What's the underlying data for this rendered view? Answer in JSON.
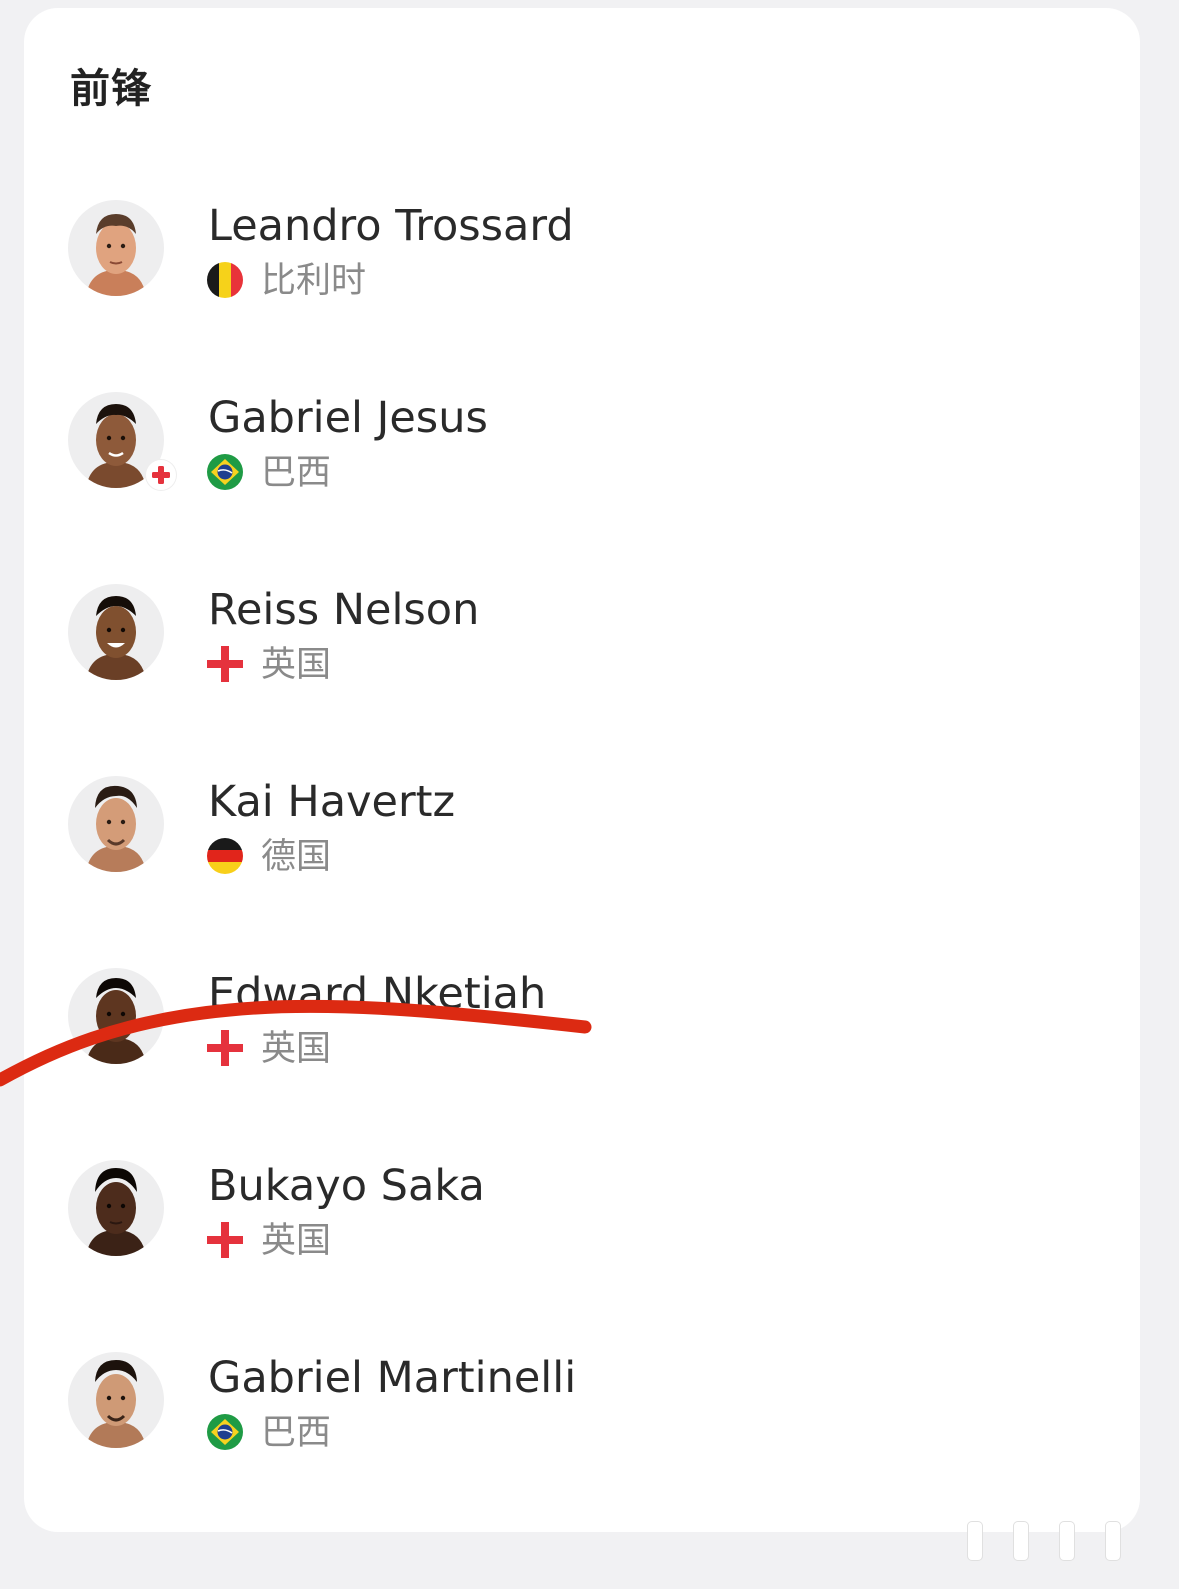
{
  "section": {
    "title": "前锋"
  },
  "players": [
    {
      "name": "Leandro Trossard",
      "country": "比利时",
      "flag": "belgium-flag-icon",
      "badge": null
    },
    {
      "name": "Gabriel Jesus",
      "country": "巴西",
      "flag": "brazil-flag-icon",
      "badge": "injury-cross-icon"
    },
    {
      "name": "Reiss Nelson",
      "country": "英国",
      "flag": "england-flag-icon",
      "badge": null
    },
    {
      "name": "Kai Havertz",
      "country": "德国",
      "flag": "germany-flag-icon",
      "badge": null
    },
    {
      "name": "Edward Nketiah",
      "country": "英国",
      "flag": "england-flag-icon",
      "badge": null
    },
    {
      "name": "Bukayo Saka",
      "country": "英国",
      "flag": "england-flag-icon",
      "badge": null
    },
    {
      "name": "Gabriel Martinelli",
      "country": "巴西",
      "flag": "brazil-flag-icon",
      "badge": null
    }
  ],
  "colors": {
    "background": "#f1f1f3",
    "card": "#ffffff",
    "name_text": "#2a2a2a",
    "country_text": "#8a8a8a",
    "strike_mark": "#dc2a12",
    "england_cross": "#e5323d"
  }
}
